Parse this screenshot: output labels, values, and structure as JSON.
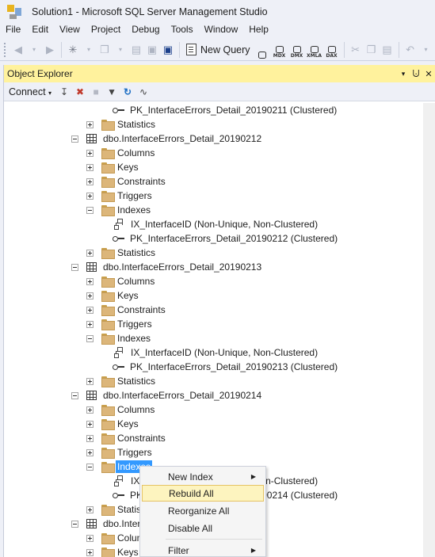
{
  "window": {
    "title": "Solution1 - Microsoft SQL Server Management Studio"
  },
  "menubar": {
    "items": [
      "File",
      "Edit",
      "View",
      "Project",
      "Debug",
      "Tools",
      "Window",
      "Help"
    ]
  },
  "toolbar": {
    "new_query_label": "New Query",
    "query_types": [
      "MDX",
      "DMX",
      "XMLA",
      "DAX"
    ]
  },
  "object_explorer": {
    "title": "Object Explorer",
    "connect_label": "Connect",
    "tree": [
      {
        "text": "PK_InterfaceErrors_Detail_20190211 (Clustered)"
      },
      {
        "text": "Statistics"
      },
      {
        "text": "dbo.InterfaceErrors_Detail_20190212"
      },
      {
        "text": "Columns"
      },
      {
        "text": "Keys"
      },
      {
        "text": "Constraints"
      },
      {
        "text": "Triggers"
      },
      {
        "text": "Indexes"
      },
      {
        "text": "IX_InterfaceID (Non-Unique, Non-Clustered)"
      },
      {
        "text": "PK_InterfaceErrors_Detail_20190212 (Clustered)"
      },
      {
        "text": "Statistics"
      },
      {
        "text": "dbo.InterfaceErrors_Detail_20190213"
      },
      {
        "text": "Columns"
      },
      {
        "text": "Keys"
      },
      {
        "text": "Constraints"
      },
      {
        "text": "Triggers"
      },
      {
        "text": "Indexes"
      },
      {
        "text": "IX_InterfaceID (Non-Unique, Non-Clustered)"
      },
      {
        "text": "PK_InterfaceErrors_Detail_20190213 (Clustered)"
      },
      {
        "text": "Statistics"
      },
      {
        "text": "dbo.InterfaceErrors_Detail_20190214"
      },
      {
        "text": "Columns"
      },
      {
        "text": "Keys"
      },
      {
        "text": "Constraints"
      },
      {
        "text": "Triggers"
      },
      {
        "text": "Indexes"
      },
      {
        "text": "IX_InterfaceID (Non-Unique, Non-Clustered)"
      },
      {
        "text": "PK_InterfaceErrors_Detail_20190214 (Clustered)"
      },
      {
        "text": "Statistics"
      },
      {
        "text": "dbo.InterfaceErrors_Detail_20190215"
      },
      {
        "text": "Columns"
      },
      {
        "text": "Keys"
      }
    ]
  },
  "context_menu": {
    "items": [
      {
        "label": "New Index",
        "submenu": true
      },
      {
        "label": "Rebuild All",
        "submenu": false
      },
      {
        "label": "Reorganize All",
        "submenu": false
      },
      {
        "label": "Disable All",
        "submenu": false
      },
      {
        "label": "Filter",
        "submenu": true
      }
    ]
  }
}
